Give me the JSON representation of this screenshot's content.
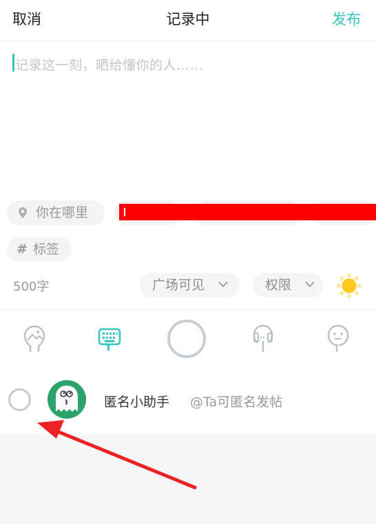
{
  "header": {
    "cancel_label": "取消",
    "title": "记录中",
    "publish_label": "发布"
  },
  "editor": {
    "placeholder": "记录这一刻，晒给懂你的人......"
  },
  "location": {
    "label": "你在哪里",
    "icon": "location-pin-icon"
  },
  "tag": {
    "label": "标签",
    "icon": "hash-icon"
  },
  "word_count": "500字",
  "visibility": {
    "label": "广场可见",
    "icon": "chevron-down-icon"
  },
  "permission": {
    "label": "权限",
    "icon": "chevron-down-icon"
  },
  "toolbar": {
    "items": [
      "image-icon",
      "keyboard-icon",
      "record-button",
      "voice-icon",
      "emoji-icon"
    ]
  },
  "anonymous": {
    "name": "匿名小助手",
    "description": "@Ta可匿名发帖"
  },
  "colors": {
    "accent": "#35c4bf",
    "redaction": "#ff0000",
    "annotation_arrow": "#ee2222",
    "sun": "#ffcc22"
  }
}
